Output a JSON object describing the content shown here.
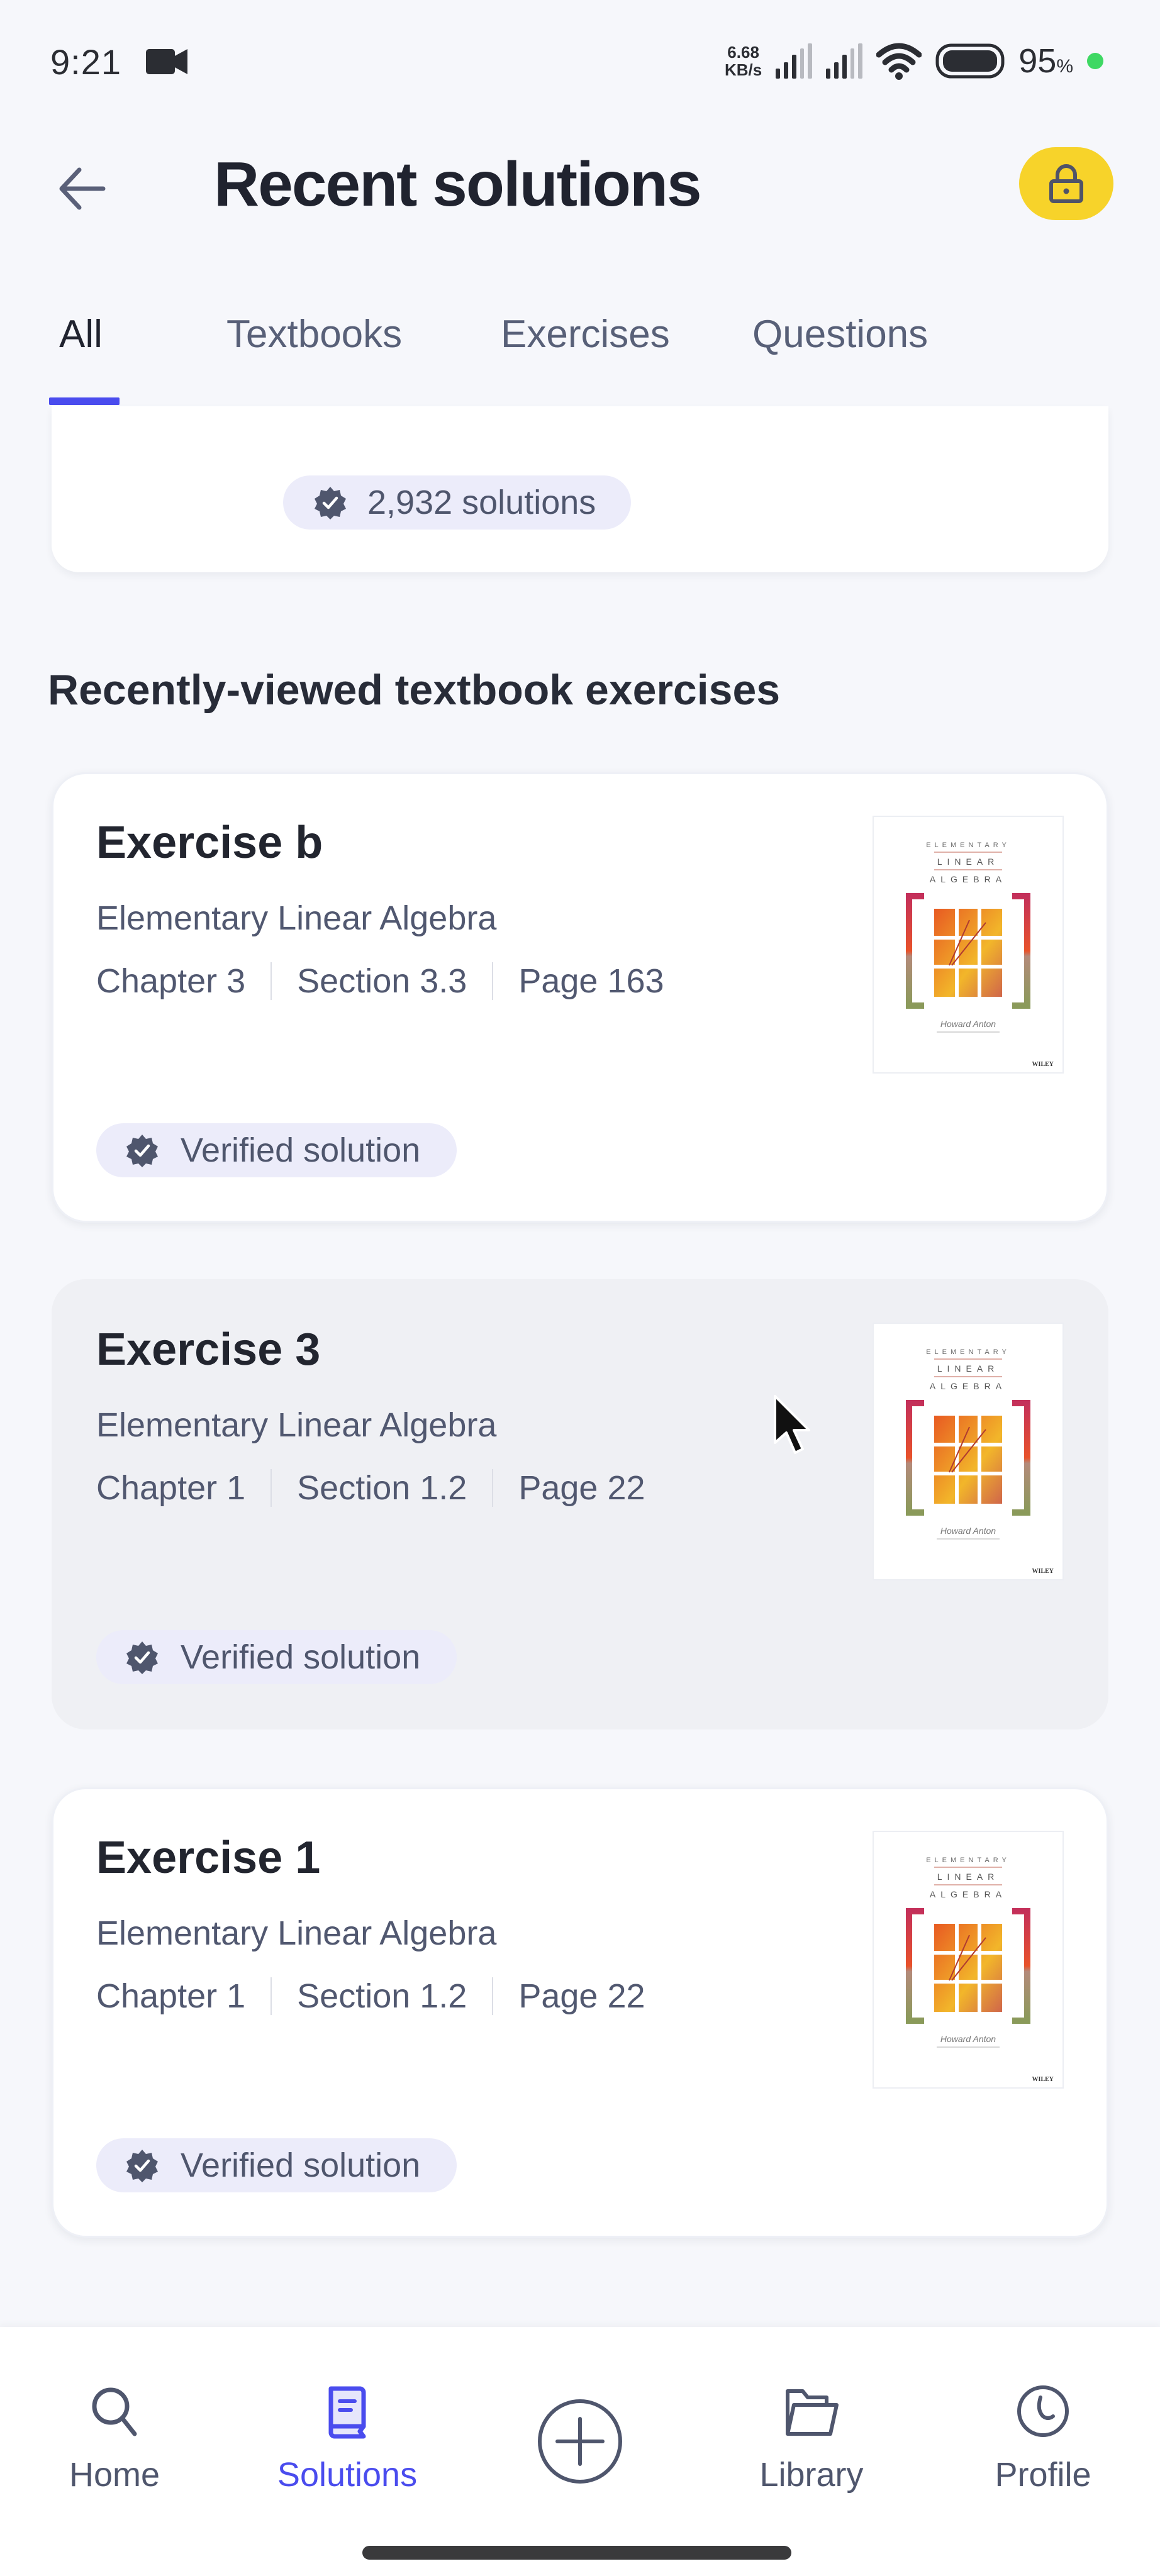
{
  "status_bar": {
    "time": "9:21",
    "net_speed_value": "6.68",
    "net_speed_unit": "KB/s",
    "battery_percent": "95",
    "battery_suffix": "%",
    "icons": [
      "video-camera-icon",
      "signal-icon",
      "signal-icon",
      "wifi-icon",
      "battery-icon",
      "green-dot-indicator"
    ]
  },
  "header": {
    "title": "Recent solutions",
    "back_icon": "arrow-left-icon",
    "lock_icon": "lock-icon",
    "accent_color": "#f7d32a"
  },
  "tabs": [
    {
      "label": "All",
      "active": true
    },
    {
      "label": "Textbooks",
      "active": false
    },
    {
      "label": "Exercises",
      "active": false
    },
    {
      "label": "Questions",
      "active": false
    }
  ],
  "top_card": {
    "solutions_count": "2,932 solutions",
    "icon": "verified-badge-icon"
  },
  "section": {
    "title": "Recently-viewed textbook exercises"
  },
  "exercises": [
    {
      "title": "Exercise b",
      "book": "Elementary Linear Algebra",
      "chapter": "Chapter 3",
      "section": "Section 3.3",
      "page": "Page 163",
      "badge": "Verified solution"
    },
    {
      "title": "Exercise 3",
      "book": "Elementary Linear Algebra",
      "chapter": "Chapter 1",
      "section": "Section 1.2",
      "page": "Page 22",
      "badge": "Verified solution"
    },
    {
      "title": "Exercise 1",
      "book": "Elementary Linear Algebra",
      "chapter": "Chapter 1",
      "section": "Section 1.2",
      "page": "Page 22",
      "badge": "Verified solution"
    }
  ],
  "cover": {
    "line1": "ELEMENTARY",
    "line2": "LINEAR",
    "line3": "ALGEBRA",
    "author": "Howard Anton",
    "publisher": "WILEY"
  },
  "bottom_nav": {
    "items": [
      {
        "label": "Home",
        "icon": "search-icon",
        "active": false
      },
      {
        "label": "Solutions",
        "icon": "book-icon",
        "active": true
      },
      {
        "label": "Library",
        "icon": "folder-icon",
        "active": false
      },
      {
        "label": "Profile",
        "icon": "profile-icon",
        "active": false
      }
    ],
    "add_icon": "plus-circle-icon",
    "active_color": "#4a4cee"
  }
}
